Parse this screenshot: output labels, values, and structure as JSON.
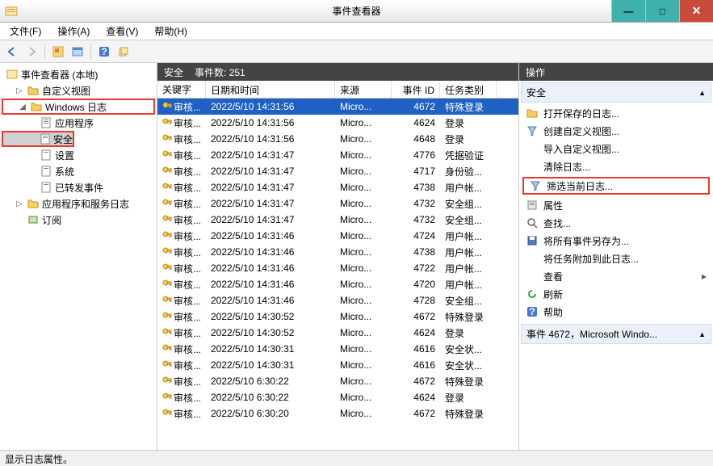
{
  "window": {
    "title": "事件查看器"
  },
  "menu": {
    "file": "文件(F)",
    "action": "操作(A)",
    "view": "查看(V)",
    "help": "帮助(H)"
  },
  "tree": {
    "root": "事件查看器 (本地)",
    "custom_views": "自定义视图",
    "windows_logs": "Windows 日志",
    "app": "应用程序",
    "security": "安全",
    "setup": "设置",
    "system": "系统",
    "forwarded": "已转发事件",
    "app_service_logs": "应用程序和服务日志",
    "subscriptions": "订阅"
  },
  "center": {
    "head_label": "安全",
    "head_count_prefix": "事件数:",
    "head_count": "251"
  },
  "columns": {
    "key": "关键字",
    "datetime": "日期和时间",
    "source": "来源",
    "eventid": "事件 ID",
    "category": "任务类别"
  },
  "events": [
    {
      "key": "审核...",
      "dt": "2022/5/10 14:31:56",
      "src": "Micro...",
      "id": 4672,
      "cat": "特殊登录",
      "selected": true
    },
    {
      "key": "审核...",
      "dt": "2022/5/10 14:31:56",
      "src": "Micro...",
      "id": 4624,
      "cat": "登录"
    },
    {
      "key": "审核...",
      "dt": "2022/5/10 14:31:56",
      "src": "Micro...",
      "id": 4648,
      "cat": "登录"
    },
    {
      "key": "审核...",
      "dt": "2022/5/10 14:31:47",
      "src": "Micro...",
      "id": 4776,
      "cat": "凭据验证"
    },
    {
      "key": "审核...",
      "dt": "2022/5/10 14:31:47",
      "src": "Micro...",
      "id": 4717,
      "cat": "身份验..."
    },
    {
      "key": "审核...",
      "dt": "2022/5/10 14:31:47",
      "src": "Micro...",
      "id": 4738,
      "cat": "用户帐..."
    },
    {
      "key": "审核...",
      "dt": "2022/5/10 14:31:47",
      "src": "Micro...",
      "id": 4732,
      "cat": "安全组..."
    },
    {
      "key": "审核...",
      "dt": "2022/5/10 14:31:47",
      "src": "Micro...",
      "id": 4732,
      "cat": "安全组..."
    },
    {
      "key": "审核...",
      "dt": "2022/5/10 14:31:46",
      "src": "Micro...",
      "id": 4724,
      "cat": "用户帐..."
    },
    {
      "key": "审核...",
      "dt": "2022/5/10 14:31:46",
      "src": "Micro...",
      "id": 4738,
      "cat": "用户帐..."
    },
    {
      "key": "审核...",
      "dt": "2022/5/10 14:31:46",
      "src": "Micro...",
      "id": 4722,
      "cat": "用户帐..."
    },
    {
      "key": "审核...",
      "dt": "2022/5/10 14:31:46",
      "src": "Micro...",
      "id": 4720,
      "cat": "用户帐..."
    },
    {
      "key": "审核...",
      "dt": "2022/5/10 14:31:46",
      "src": "Micro...",
      "id": 4728,
      "cat": "安全组..."
    },
    {
      "key": "审核...",
      "dt": "2022/5/10 14:30:52",
      "src": "Micro...",
      "id": 4672,
      "cat": "特殊登录"
    },
    {
      "key": "审核...",
      "dt": "2022/5/10 14:30:52",
      "src": "Micro...",
      "id": 4624,
      "cat": "登录"
    },
    {
      "key": "审核...",
      "dt": "2022/5/10 14:30:31",
      "src": "Micro...",
      "id": 4616,
      "cat": "安全状..."
    },
    {
      "key": "审核...",
      "dt": "2022/5/10 14:30:31",
      "src": "Micro...",
      "id": 4616,
      "cat": "安全状..."
    },
    {
      "key": "审核...",
      "dt": "2022/5/10 6:30:22",
      "src": "Micro...",
      "id": 4672,
      "cat": "特殊登录"
    },
    {
      "key": "审核...",
      "dt": "2022/5/10 6:30:22",
      "src": "Micro...",
      "id": 4624,
      "cat": "登录"
    },
    {
      "key": "审核...",
      "dt": "2022/5/10 6:30:20",
      "src": "Micro...",
      "id": 4672,
      "cat": "特殊登录"
    }
  ],
  "actions": {
    "title": "操作",
    "section1": "安全",
    "open_saved": "打开保存的日志...",
    "create_custom": "创建自定义视图...",
    "import_custom": "导入自定义视图...",
    "clear_log": "清除日志...",
    "filter_current": "筛选当前日志...",
    "properties": "属性",
    "find": "查找...",
    "save_all": "将所有事件另存为...",
    "attach_task": "将任务附加到此日志...",
    "view": "查看",
    "refresh": "刷新",
    "help": "帮助",
    "section2": "事件 4672，Microsoft Windo..."
  },
  "status": "显示日志属性。"
}
